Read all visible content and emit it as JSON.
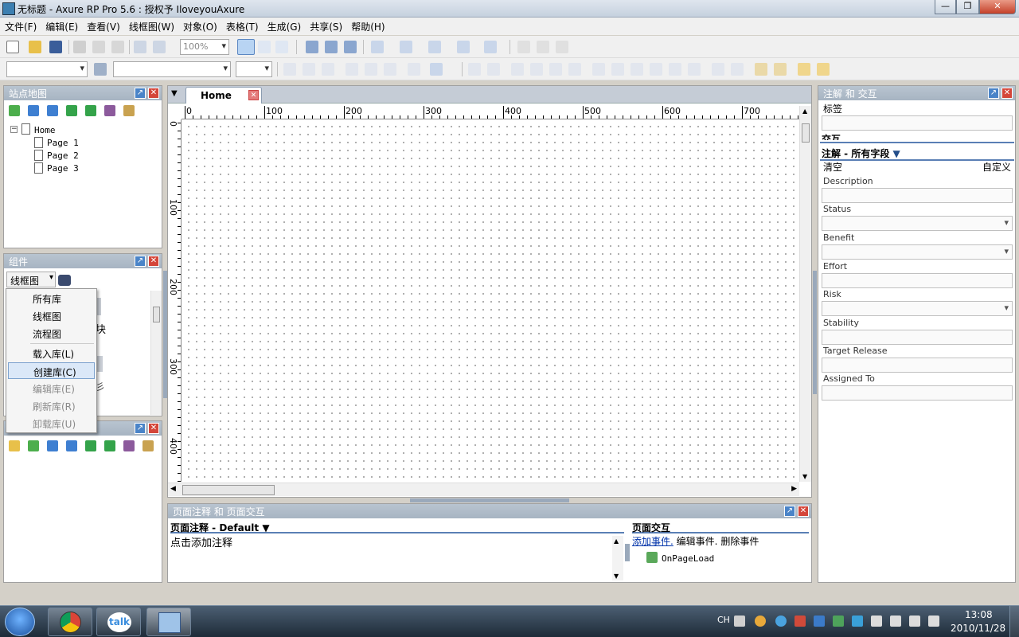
{
  "window": {
    "title": "无标题 - Axure RP Pro 5.6 : 授权予 IloveyouAxure",
    "minimize": "—",
    "maximize": "❐",
    "close": "✕"
  },
  "menubar": [
    "文件(F)",
    "编辑(E)",
    "查看(V)",
    "线框图(W)",
    "对象(O)",
    "表格(T)",
    "生成(G)",
    "共享(S)",
    "帮助(H)"
  ],
  "toolbar": {
    "zoom": "100%"
  },
  "sitemap": {
    "title": "站点地图",
    "root": "Home",
    "pages": [
      "Page 1",
      "Page 2",
      "Page 3"
    ]
  },
  "widgets": {
    "title": "组件",
    "library_select": "线框图",
    "partial_text": "块",
    "partial_text2": "彡",
    "menu": [
      {
        "label": "所有库",
        "enabled": true
      },
      {
        "label": "线框图",
        "enabled": true
      },
      {
        "label": "流程图",
        "enabled": true
      },
      {
        "label": "载入库(L)",
        "enabled": true
      },
      {
        "label": "创建库(C)",
        "enabled": true,
        "highlighted": true
      },
      {
        "label": "编辑库(E)",
        "enabled": false
      },
      {
        "label": "刷新库(R)",
        "enabled": false
      },
      {
        "label": "卸载库(U)",
        "enabled": false
      }
    ]
  },
  "canvas": {
    "tab": "Home",
    "hruler": [
      "0",
      "100",
      "200",
      "300",
      "400",
      "500",
      "600",
      "700"
    ],
    "vruler": [
      "0",
      "100",
      "200",
      "300",
      "400"
    ]
  },
  "page_notes": {
    "panel_title": "页面注释 和 页面交互",
    "notes_header": "页面注释 - Default",
    "notes_placeholder": "点击添加注释",
    "interactions_header": "页面交互",
    "add_event": "添加事件.",
    "edit_event": "编辑事件.",
    "delete_event": "删除事件",
    "event": "OnPageLoad"
  },
  "annotations": {
    "panel_title": "注解 和 交互",
    "label_field": "标签",
    "interact_tab": "交互",
    "fields_header": "注解 - 所有字段",
    "clear": "清空",
    "custom": "自定义",
    "fields": [
      {
        "label": "Description",
        "type": "text"
      },
      {
        "label": "Status",
        "type": "select"
      },
      {
        "label": "Benefit",
        "type": "select"
      },
      {
        "label": "Effort",
        "type": "text"
      },
      {
        "label": "Risk",
        "type": "select"
      },
      {
        "label": "Stability",
        "type": "text"
      },
      {
        "label": "Target Release",
        "type": "text"
      },
      {
        "label": "Assigned To",
        "type": "text"
      }
    ]
  },
  "taskbar": {
    "apps": [
      "chrome",
      "talk",
      "axure"
    ],
    "talk_label": "talk",
    "lang": "CH",
    "time": "13:08",
    "date": "2010/11/28"
  }
}
